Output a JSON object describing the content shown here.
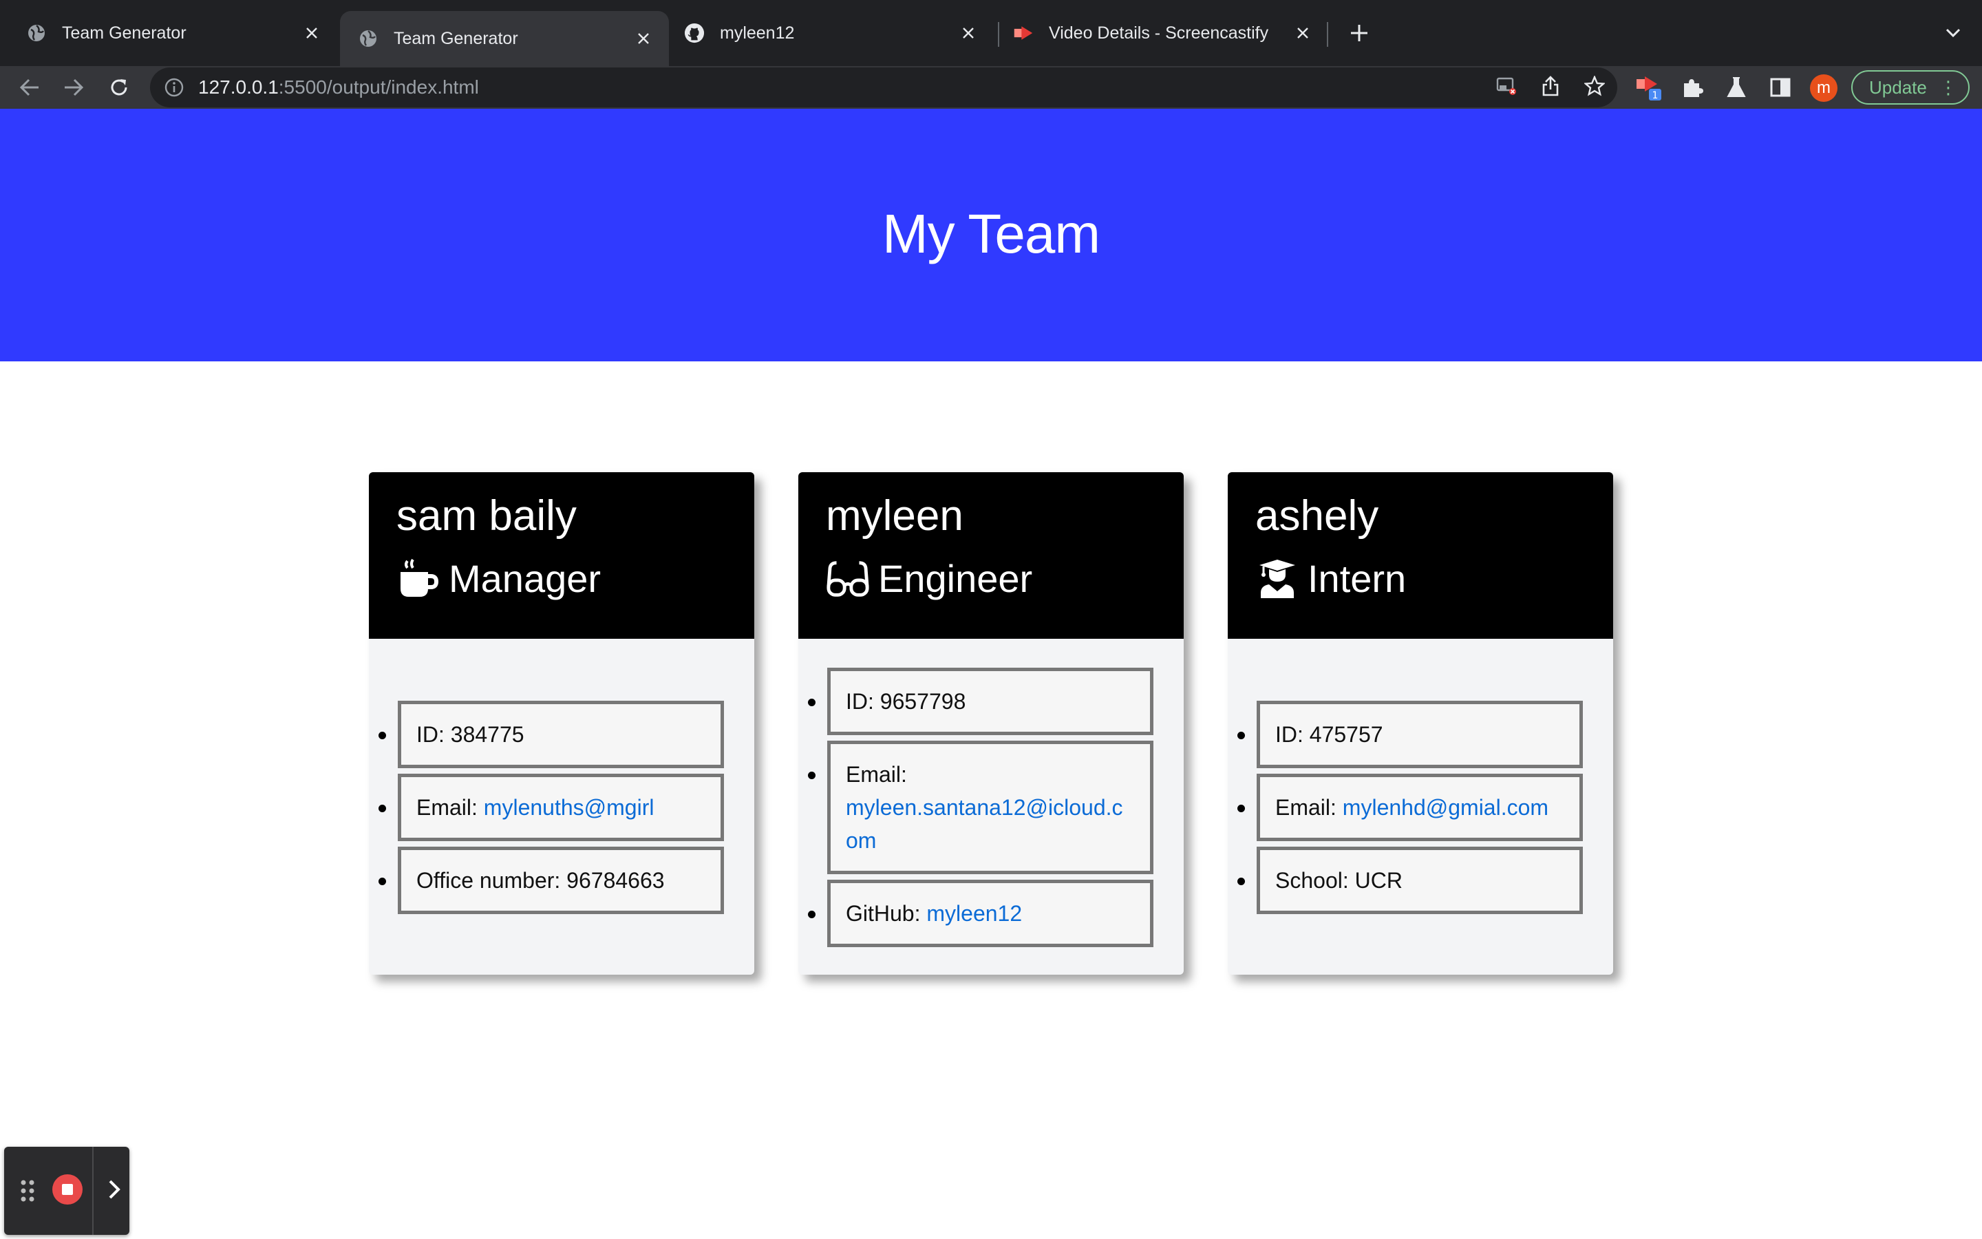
{
  "browser": {
    "tabs": [
      {
        "title": "Team Generator",
        "favicon": "globe-icon",
        "active": false
      },
      {
        "title": "Team Generator",
        "favicon": "globe-icon",
        "active": true
      },
      {
        "title": "myleen12",
        "favicon": "github-icon",
        "active": false
      },
      {
        "title": "Video Details - Screencastify",
        "favicon": "screencastify-icon",
        "active": false
      }
    ],
    "url_host": "127.0.0.1",
    "url_rest": ":5500/output/index.html",
    "profile_initial": "m",
    "update_label": "Update",
    "extension_badge": "1"
  },
  "page": {
    "heading": "My Team",
    "hero_color": "#303aff",
    "link_color": "#0b6bd6"
  },
  "cards": [
    {
      "name": "sam baily",
      "role": "Manager",
      "role_icon": "coffee-mug-icon",
      "fields": [
        {
          "label": "ID: 384775",
          "link": ""
        },
        {
          "label": "Email: ",
          "link": "mylenuths@mgirl"
        },
        {
          "label": "Office number: 96784663",
          "link": ""
        }
      ]
    },
    {
      "name": "myleen",
      "role": "Engineer",
      "role_icon": "glasses-icon",
      "fields": [
        {
          "label": "ID: 9657798",
          "link": ""
        },
        {
          "label": "Email:",
          "link": "myleen.santana12@icloud.com"
        },
        {
          "label": "GitHub: ",
          "link": "myleen12"
        }
      ]
    },
    {
      "name": "ashely",
      "role": "Intern",
      "role_icon": "graduate-icon",
      "fields": [
        {
          "label": "ID: 475757",
          "link": ""
        },
        {
          "label": "Email: ",
          "link": "mylenhd@gmial.com"
        },
        {
          "label": "School: UCR",
          "link": ""
        }
      ]
    }
  ]
}
